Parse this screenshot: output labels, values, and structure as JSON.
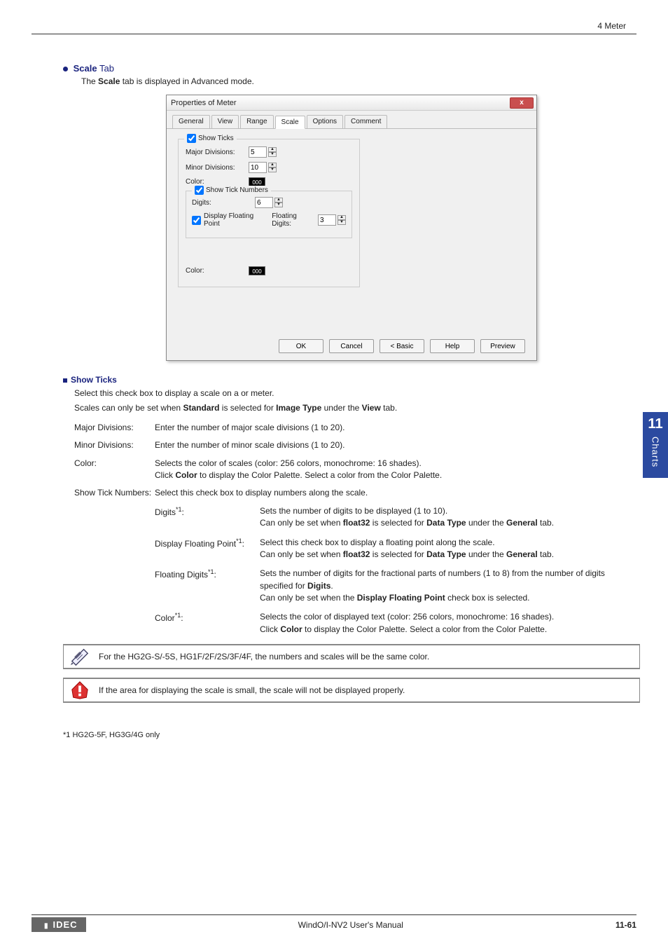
{
  "header": {
    "right": "4 Meter"
  },
  "section": {
    "bullet_heading_prefix": "Scale",
    "bullet_heading_suffix": " Tab",
    "desc_a": "The ",
    "desc_b": "Scale",
    "desc_c": " tab is displayed in Advanced mode."
  },
  "dialog": {
    "title": "Properties of Meter",
    "close": "x",
    "tabs": [
      "General",
      "View",
      "Range",
      "Scale",
      "Options",
      "Comment"
    ],
    "show_ticks_label": "Show Ticks",
    "major_div_label": "Major Divisions:",
    "major_div_value": "5",
    "minor_div_label": "Minor Divisions:",
    "minor_div_value": "10",
    "color_label": "Color:",
    "color_swatch": "000",
    "show_tick_numbers_label": "Show Tick Numbers",
    "digits_label": "Digits:",
    "digits_value": "6",
    "display_floating_label": "Display Floating Point",
    "floating_digits_label": "Floating Digits:",
    "floating_digits_value": "3",
    "color2_label": "Color:",
    "color2_swatch": "000",
    "btn_ok": "OK",
    "btn_cancel": "Cancel",
    "btn_basic": "< Basic",
    "btn_help": "Help",
    "btn_preview": "Preview"
  },
  "show_ticks": {
    "heading": "Show Ticks",
    "p1": "Select this check box to display a scale on a or meter.",
    "p2a": "Scales can only be set when ",
    "p2b": "Standard",
    "p2c": " is selected for ",
    "p2d": "Image Type",
    "p2e": " under the ",
    "p2f": "View",
    "p2g": " tab."
  },
  "defs": {
    "major_term": "Major Divisions:",
    "major_desc": "Enter the number of major scale divisions (1 to 20).",
    "minor_term": "Minor Divisions:",
    "minor_desc": "Enter the number of minor scale divisions (1 to 20).",
    "color_term": "Color:",
    "color_desc_a": "Selects the color of scales (color: 256 colors, monochrome: 16 shades).",
    "color_desc_b1": "Click ",
    "color_desc_b2": "Color",
    "color_desc_b3": " to display the Color Palette. Select a color from the Color Palette.",
    "stn_term": "Show Tick Numbers:",
    "stn_desc": "Select this check box to display numbers along the scale."
  },
  "subdefs": {
    "digits_term_a": "Digits",
    "digits_term_b": "*1",
    "digits_term_c": ":",
    "digits_desc_a": "Sets the number of digits to be displayed (1 to 10).",
    "digits_desc_b1": "Can only be set when ",
    "digits_desc_b2": "float32",
    "digits_desc_b3": " is selected for ",
    "digits_desc_b4": "Data Type",
    "digits_desc_b5": " under the ",
    "digits_desc_b6": "General",
    "digits_desc_b7": " tab.",
    "dfp_term_a": "Display Floating Point",
    "dfp_term_b": "*1",
    "dfp_term_c": ":",
    "dfp_desc_a": "Select this check box to display a floating point along the scale.",
    "dfp_desc_b1": "Can only be set when ",
    "dfp_desc_b2": "float32",
    "dfp_desc_b3": " is selected for ",
    "dfp_desc_b4": "Data Type",
    "dfp_desc_b5": " under the ",
    "dfp_desc_b6": "General",
    "dfp_desc_b7": " tab.",
    "fd_term_a": "Floating Digits",
    "fd_term_b": "*1",
    "fd_term_c": ":",
    "fd_desc_a": "Sets the number of digits for the fractional parts of numbers (1 to 8) from the number of digits specified for ",
    "fd_desc_a2": "Digits",
    "fd_desc_a3": ".",
    "fd_desc_b1": "Can only be set when the ",
    "fd_desc_b2": "Display Floating Point",
    "fd_desc_b3": " check box is selected.",
    "col_term_a": "Color",
    "col_term_b": "*1",
    "col_term_c": ":",
    "col_desc_a": "Selects the color of displayed text (color: 256 colors, monochrome: 16 shades).",
    "col_desc_b1": "Click ",
    "col_desc_b2": "Color",
    "col_desc_b3": " to display the Color Palette. Select a color from the Color Palette."
  },
  "note1": "For the HG2G-S/-5S, HG1F/2F/2S/3F/4F, the numbers and scales will be the same color.",
  "note2": "If the area for displaying the scale is small, the scale will not be displayed properly.",
  "footnote": "*1  HG2G-5F, HG3G/4G only",
  "footer": {
    "logo": "IDEC",
    "center": "WindO/I-NV2 User's Manual",
    "page": "11-61"
  },
  "sidetab": {
    "num": "11",
    "txt": "Charts"
  }
}
